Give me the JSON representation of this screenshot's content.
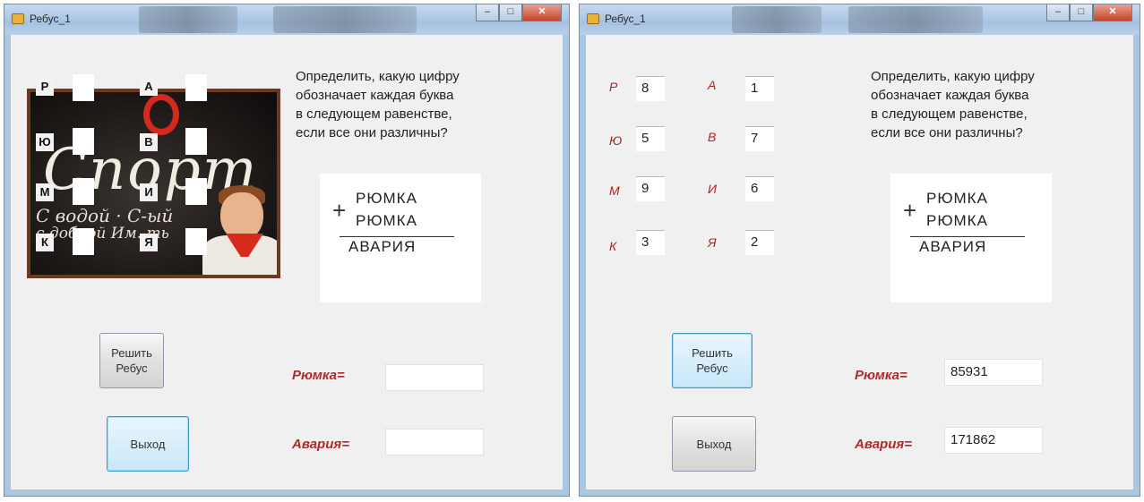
{
  "left_window": {
    "title": "Ребус_1",
    "poster_letters": [
      "Р",
      "А",
      "Ю",
      "В",
      "М",
      "И",
      "К",
      "Я"
    ],
    "task_lines": [
      "Определить, какую цифру",
      "обозначает каждая  буква",
      "в следующем равенстве,",
      "если все они различны?"
    ],
    "rebus": {
      "word1": "РЮМКА",
      "word2": "РЮМКА",
      "result": "АВАРИЯ",
      "plus": "+"
    },
    "solve_button": "Решить Ребус",
    "exit_button": "Выход",
    "ryumka_label": "Рюмка=",
    "ryumka_value": "",
    "avariya_label": "Авария=",
    "avariya_value": ""
  },
  "right_window": {
    "title": "Ребус_1",
    "letters": [
      {
        "letter": "Р",
        "value": "8"
      },
      {
        "letter": "А",
        "value": "1"
      },
      {
        "letter": "Ю",
        "value": "5"
      },
      {
        "letter": "В",
        "value": "7"
      },
      {
        "letter": "М",
        "value": "9"
      },
      {
        "letter": "И",
        "value": "6"
      },
      {
        "letter": "К",
        "value": "3"
      },
      {
        "letter": "Я",
        "value": "2"
      }
    ],
    "task_lines": [
      "Определить, какую цифру",
      "обозначает каждая  буква",
      "в следующем равенстве,",
      "если все они различны?"
    ],
    "rebus": {
      "word1": "РЮМКА",
      "word2": "РЮМКА",
      "result": "АВАРИЯ",
      "plus": "+"
    },
    "solve_button": "Решить Ребус",
    "exit_button": "Выход",
    "ryumka_label": "Рюмка=",
    "ryumka_value": "85931",
    "avariya_label": "Авария=",
    "avariya_value": "171862"
  }
}
